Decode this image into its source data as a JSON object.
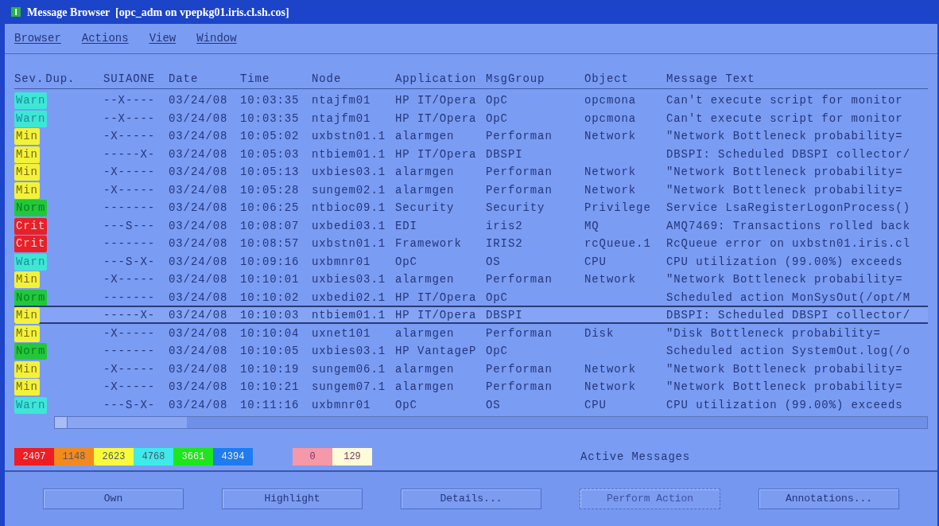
{
  "window": {
    "title": "Message Browser  [opc_adm on vpepkg01.iris.cl.sh.cos]"
  },
  "menu": [
    {
      "label": "Browser"
    },
    {
      "label": "Actions"
    },
    {
      "label": "View"
    },
    {
      "label": "Window"
    }
  ],
  "table": {
    "columns": [
      "Sev.",
      "Dup.",
      "SUIAONE",
      "Date",
      "Time",
      "Node",
      "Application",
      "MsgGroup",
      "Object",
      "Message Text"
    ],
    "rows": [
      {
        "severity": "Warn",
        "color": "#3ee6d6",
        "flags": "--X----",
        "date": "03/24/08",
        "time": "10:03:35",
        "node": "ntajfm01",
        "application": "HP IT/Opera",
        "msggroup": "OpC",
        "object": "opcmona",
        "message": "Can't execute script for monitor",
        "selected": false
      },
      {
        "severity": "Warn",
        "color": "#3ee6d6",
        "flags": "--X----",
        "date": "03/24/08",
        "time": "10:03:35",
        "node": "ntajfm01",
        "application": "HP IT/Opera",
        "msggroup": "OpC",
        "object": "opcmona",
        "message": "Can't execute script for monitor",
        "selected": false
      },
      {
        "severity": "Min",
        "color": "#f2f23a",
        "flags": "-X-----",
        "date": "03/24/08",
        "time": "10:05:02",
        "node": "uxbstn01.1",
        "application": "alarmgen",
        "msggroup": "Performan",
        "object": "Network",
        "message": "\"Network Bottleneck probability=",
        "selected": false
      },
      {
        "severity": "Min",
        "color": "#f2f23a",
        "flags": "-----X-",
        "date": "03/24/08",
        "time": "10:05:03",
        "node": "ntbiem01.1",
        "application": "HP IT/Opera",
        "msggroup": "DBSPI",
        "object": "",
        "message": "DBSPI: Scheduled DBSPI collector/",
        "selected": false
      },
      {
        "severity": "Min",
        "color": "#f2f23a",
        "flags": "-X-----",
        "date": "03/24/08",
        "time": "10:05:13",
        "node": "uxbies03.1",
        "application": "alarmgen",
        "msggroup": "Performan",
        "object": "Network",
        "message": "\"Network Bottleneck probability=",
        "selected": false
      },
      {
        "severity": "Min",
        "color": "#f2f23a",
        "flags": "-X-----",
        "date": "03/24/08",
        "time": "10:05:28",
        "node": "sungem02.1",
        "application": "alarmgen",
        "msggroup": "Performan",
        "object": "Network",
        "message": "\"Network Bottleneck probability=",
        "selected": false
      },
      {
        "severity": "Norm",
        "color": "#22c83c",
        "flags": "-------",
        "date": "03/24/08",
        "time": "10:06:25",
        "node": "ntbioc09.1",
        "application": "Security",
        "msggroup": "Security",
        "object": "Privilege",
        "message": "Service LsaRegisterLogonProcess()",
        "selected": false
      },
      {
        "severity": "Crit",
        "color": "#e8202a",
        "flags": "---S---",
        "date": "03/24/08",
        "time": "10:08:07",
        "node": "uxbedi03.1",
        "application": "EDI",
        "msggroup": "iris2",
        "object": "MQ",
        "message": "AMQ7469: Transactions rolled back",
        "selected": false
      },
      {
        "severity": "Crit",
        "color": "#e8202a",
        "flags": "-------",
        "date": "03/24/08",
        "time": "10:08:57",
        "node": "uxbstn01.1",
        "application": "Framework",
        "msggroup": "IRIS2",
        "object": "rcQueue.1",
        "message": "RcQueue error on uxbstn01.iris.cl",
        "selected": false
      },
      {
        "severity": "Warn",
        "color": "#3ee6d6",
        "flags": "---S-X-",
        "date": "03/24/08",
        "time": "10:09:16",
        "node": "uxbmnr01",
        "application": "OpC",
        "msggroup": "OS",
        "object": "CPU",
        "message": "CPU utilization (99.00%) exceeds",
        "selected": false
      },
      {
        "severity": "Min",
        "color": "#f2f23a",
        "flags": "-X-----",
        "date": "03/24/08",
        "time": "10:10:01",
        "node": "uxbies03.1",
        "application": "alarmgen",
        "msggroup": "Performan",
        "object": "Network",
        "message": "\"Network Bottleneck probability=",
        "selected": false
      },
      {
        "severity": "Norm",
        "color": "#22c83c",
        "flags": "-------",
        "date": "03/24/08",
        "time": "10:10:02",
        "node": "uxbedi02.1",
        "application": "HP IT/Opera",
        "msggroup": "OpC",
        "object": "",
        "message": "Scheduled action MonSysOut(/opt/M",
        "selected": false
      },
      {
        "severity": "Min",
        "color": "#f2f23a",
        "flags": "-----X-",
        "date": "03/24/08",
        "time": "10:10:03",
        "node": "ntbiem01.1",
        "application": "HP IT/Opera",
        "msggroup": "DBSPI",
        "object": "",
        "message": "DBSPI: Scheduled DBSPI collector/",
        "selected": true
      },
      {
        "severity": "Min",
        "color": "#f2f23a",
        "flags": "-X-----",
        "date": "03/24/08",
        "time": "10:10:04",
        "node": "uxnet101",
        "application": "alarmgen",
        "msggroup": "Performan",
        "object": "Disk",
        "message": "\"Disk Bottleneck probability=",
        "selected": false
      },
      {
        "severity": "Norm",
        "color": "#22c83c",
        "flags": "-------",
        "date": "03/24/08",
        "time": "10:10:05",
        "node": "uxbies03.1",
        "application": "HP VantageP",
        "msggroup": "OpC",
        "object": "",
        "message": "Scheduled action SystemOut.log(/o",
        "selected": false
      },
      {
        "severity": "Min",
        "color": "#f2f23a",
        "flags": "-X-----",
        "date": "03/24/08",
        "time": "10:10:19",
        "node": "sungem06.1",
        "application": "alarmgen",
        "msggroup": "Performan",
        "object": "Network",
        "message": "\"Network Bottleneck probability=",
        "selected": false
      },
      {
        "severity": "Min",
        "color": "#f2f23a",
        "flags": "-X-----",
        "date": "03/24/08",
        "time": "10:10:21",
        "node": "sungem07.1",
        "application": "alarmgen",
        "msggroup": "Performan",
        "object": "Network",
        "message": "\"Network Bottleneck probability=",
        "selected": false
      },
      {
        "severity": "Warn",
        "color": "#3ee6d6",
        "flags": "---S-X-",
        "date": "03/24/08",
        "time": "10:11:16",
        "node": "uxbmnr01",
        "application": "OpC",
        "msggroup": "OS",
        "object": "CPU",
        "message": "CPU utilization (99.00%) exceeds",
        "selected": false
      }
    ]
  },
  "counters": [
    {
      "value": "2407",
      "color": "#ee1c24"
    },
    {
      "value": "1148",
      "color": "#f28a1e"
    },
    {
      "value": "2623",
      "color": "#fafa3c"
    },
    {
      "value": "4768",
      "color": "#3eeaea"
    },
    {
      "value": "3661",
      "color": "#1ee61e"
    },
    {
      "value": "4394",
      "color": "#1e7cf0"
    }
  ],
  "extra_counters": [
    {
      "value": "0",
      "color": "#f598a8"
    },
    {
      "value": "129",
      "color": "#fdfbd8"
    }
  ],
  "counter_label": "Active Messages",
  "buttons": [
    {
      "label": "Own",
      "disabled": false
    },
    {
      "label": "Highlight",
      "disabled": false
    },
    {
      "label": "Details...",
      "disabled": false
    },
    {
      "label": "Perform Action",
      "disabled": true
    },
    {
      "label": "Annotations...",
      "disabled": false
    }
  ]
}
